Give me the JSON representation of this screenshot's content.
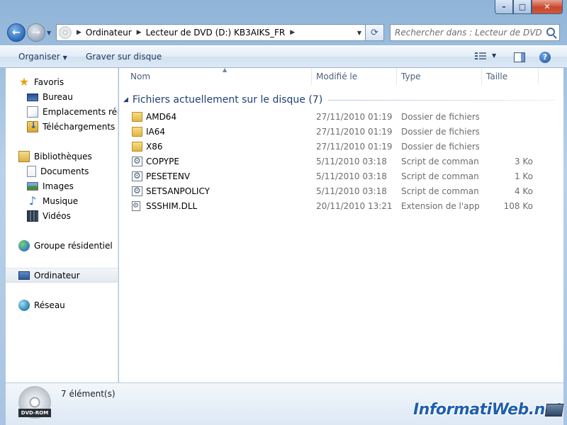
{
  "window": {
    "controls": {
      "minimize": "–",
      "maximize": "□",
      "close": "✕"
    }
  },
  "address": {
    "breadcrumbs": [
      "Ordinateur",
      "Lecteur de DVD (D:) KB3AIKS_FR"
    ],
    "search_placeholder": "Rechercher dans : Lecteur de DVD (D:..."
  },
  "toolbar": {
    "organize": "Organiser",
    "burn": "Graver sur disque",
    "help": "?"
  },
  "sidebar": {
    "items": [
      {
        "label": "Favoris",
        "icon": "star-icon",
        "kind": "group"
      },
      {
        "label": "Bureau",
        "icon": "desktop-icon",
        "kind": "child"
      },
      {
        "label": "Emplacements récents",
        "icon": "recent-places-icon",
        "kind": "child"
      },
      {
        "label": "Téléchargements",
        "icon": "downloads-icon",
        "kind": "child"
      },
      {
        "label": "Bibliothèques",
        "icon": "libraries-icon",
        "kind": "group"
      },
      {
        "label": "Documents",
        "icon": "document-icon",
        "kind": "child"
      },
      {
        "label": "Images",
        "icon": "pictures-icon",
        "kind": "child"
      },
      {
        "label": "Musique",
        "icon": "music-icon",
        "kind": "child"
      },
      {
        "label": "Vidéos",
        "icon": "video-icon",
        "kind": "child"
      },
      {
        "label": "Groupe résidentiel",
        "icon": "homegroup-icon",
        "kind": "group"
      },
      {
        "label": "Ordinateur",
        "icon": "computer-icon",
        "kind": "group",
        "selected": true
      },
      {
        "label": "Réseau",
        "icon": "network-icon",
        "kind": "group"
      }
    ]
  },
  "columns": {
    "name": "Nom",
    "modified": "Modifié le",
    "type": "Type",
    "size": "Taille"
  },
  "group_title": "Fichiers actuellement sur le disque (7)",
  "files": [
    {
      "name": "AMD64",
      "modified": "27/11/2010 01:19",
      "type": "Dossier de fichiers",
      "size": "",
      "icon": "folder-icon"
    },
    {
      "name": "IA64",
      "modified": "27/11/2010 01:19",
      "type": "Dossier de fichiers",
      "size": "",
      "icon": "folder-icon"
    },
    {
      "name": "X86",
      "modified": "27/11/2010 01:19",
      "type": "Dossier de fichiers",
      "size": "",
      "icon": "folder-icon"
    },
    {
      "name": "COPYPE",
      "modified": "5/11/2010 03:18",
      "type": "Script de comman...",
      "size": "3 Ko",
      "icon": "script-icon"
    },
    {
      "name": "PESETENV",
      "modified": "5/11/2010 03:18",
      "type": "Script de comman...",
      "size": "1 Ko",
      "icon": "script-icon"
    },
    {
      "name": "SETSANPOLICY",
      "modified": "5/11/2010 03:18",
      "type": "Script de comman...",
      "size": "4 Ko",
      "icon": "script-icon"
    },
    {
      "name": "SSSHIM.DLL",
      "modified": "20/11/2010 13:21",
      "type": "Extension de l'app...",
      "size": "108 Ko",
      "icon": "dll-icon"
    }
  ],
  "status": {
    "count": "7 élément(s)",
    "drive_label": "DVD-ROM"
  },
  "watermark": "InformatiWeb.net"
}
